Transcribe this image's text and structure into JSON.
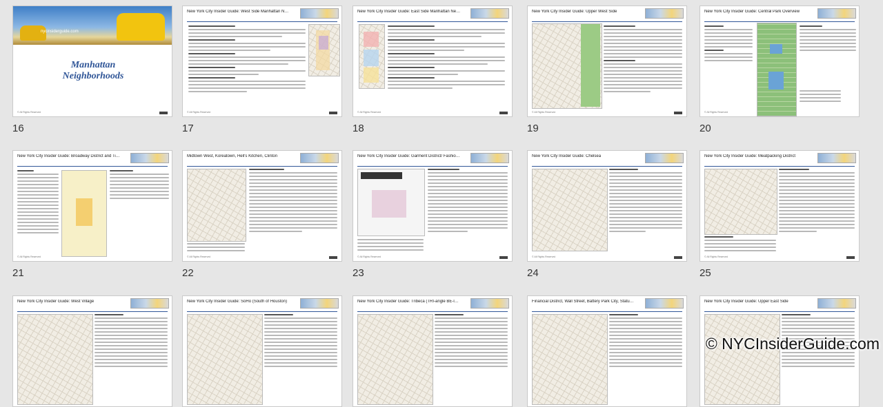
{
  "slides": [
    {
      "number": "16",
      "title": "Manhattan Neighborhoods",
      "url": "www.nycinsiderguide.com",
      "kind": "cover"
    },
    {
      "number": "17",
      "title": "New York City Insider Guide: West Side Manhattan Neighborhoods",
      "kind": "text-map-right"
    },
    {
      "number": "18",
      "title": "New York City Insider Guide: East Side Manhattan Neighborhoods",
      "kind": "map-left-text"
    },
    {
      "number": "19",
      "title": "New York City Insider Guide: Upper West Side",
      "kind": "map-left-text"
    },
    {
      "number": "20",
      "title": "New York City Insider Guide: Central Park Overview",
      "kind": "park"
    },
    {
      "number": "21",
      "title": "New York City Insider Guide: Broadway District and Times Square",
      "kind": "times-square"
    },
    {
      "number": "22",
      "title": "Midtown West, Koreatown, Hell's Kitchen, Clinton",
      "kind": "map-left-text"
    },
    {
      "number": "23",
      "title": "New York City Insider Guide: Garment District/ Fashion Center",
      "kind": "fashion"
    },
    {
      "number": "24",
      "title": "New York City Insider Guide: Chelsea",
      "kind": "map-left-text"
    },
    {
      "number": "25",
      "title": "New York City Insider Guide: Meatpacking District",
      "kind": "map-left-text"
    },
    {
      "number": "",
      "title": "New York City Insider Guide: West Village",
      "kind": "partial"
    },
    {
      "number": "",
      "title": "New York City Insider Guide: SoHo (South of Houston)",
      "kind": "partial"
    },
    {
      "number": "",
      "title": "New York City Insider Guide: Tribeca (TRI-angle BE-low CA-nal)",
      "kind": "partial"
    },
    {
      "number": "",
      "title": "Financial District, Wall Street, Battery Park City, Statue of Liberty",
      "kind": "partial"
    },
    {
      "number": "",
      "title": "New York City Insider Guide: Upper East Side",
      "kind": "partial"
    }
  ],
  "cover": {
    "line1": "Manhattan",
    "line2": "Neighborhoods",
    "site": "nycinsiderguide.com"
  },
  "watermark": "© NYCInsiderGuide.com",
  "colors": {
    "accent": "#2f5597",
    "taxi": "#f2c40f",
    "background": "#e6e6e6"
  }
}
